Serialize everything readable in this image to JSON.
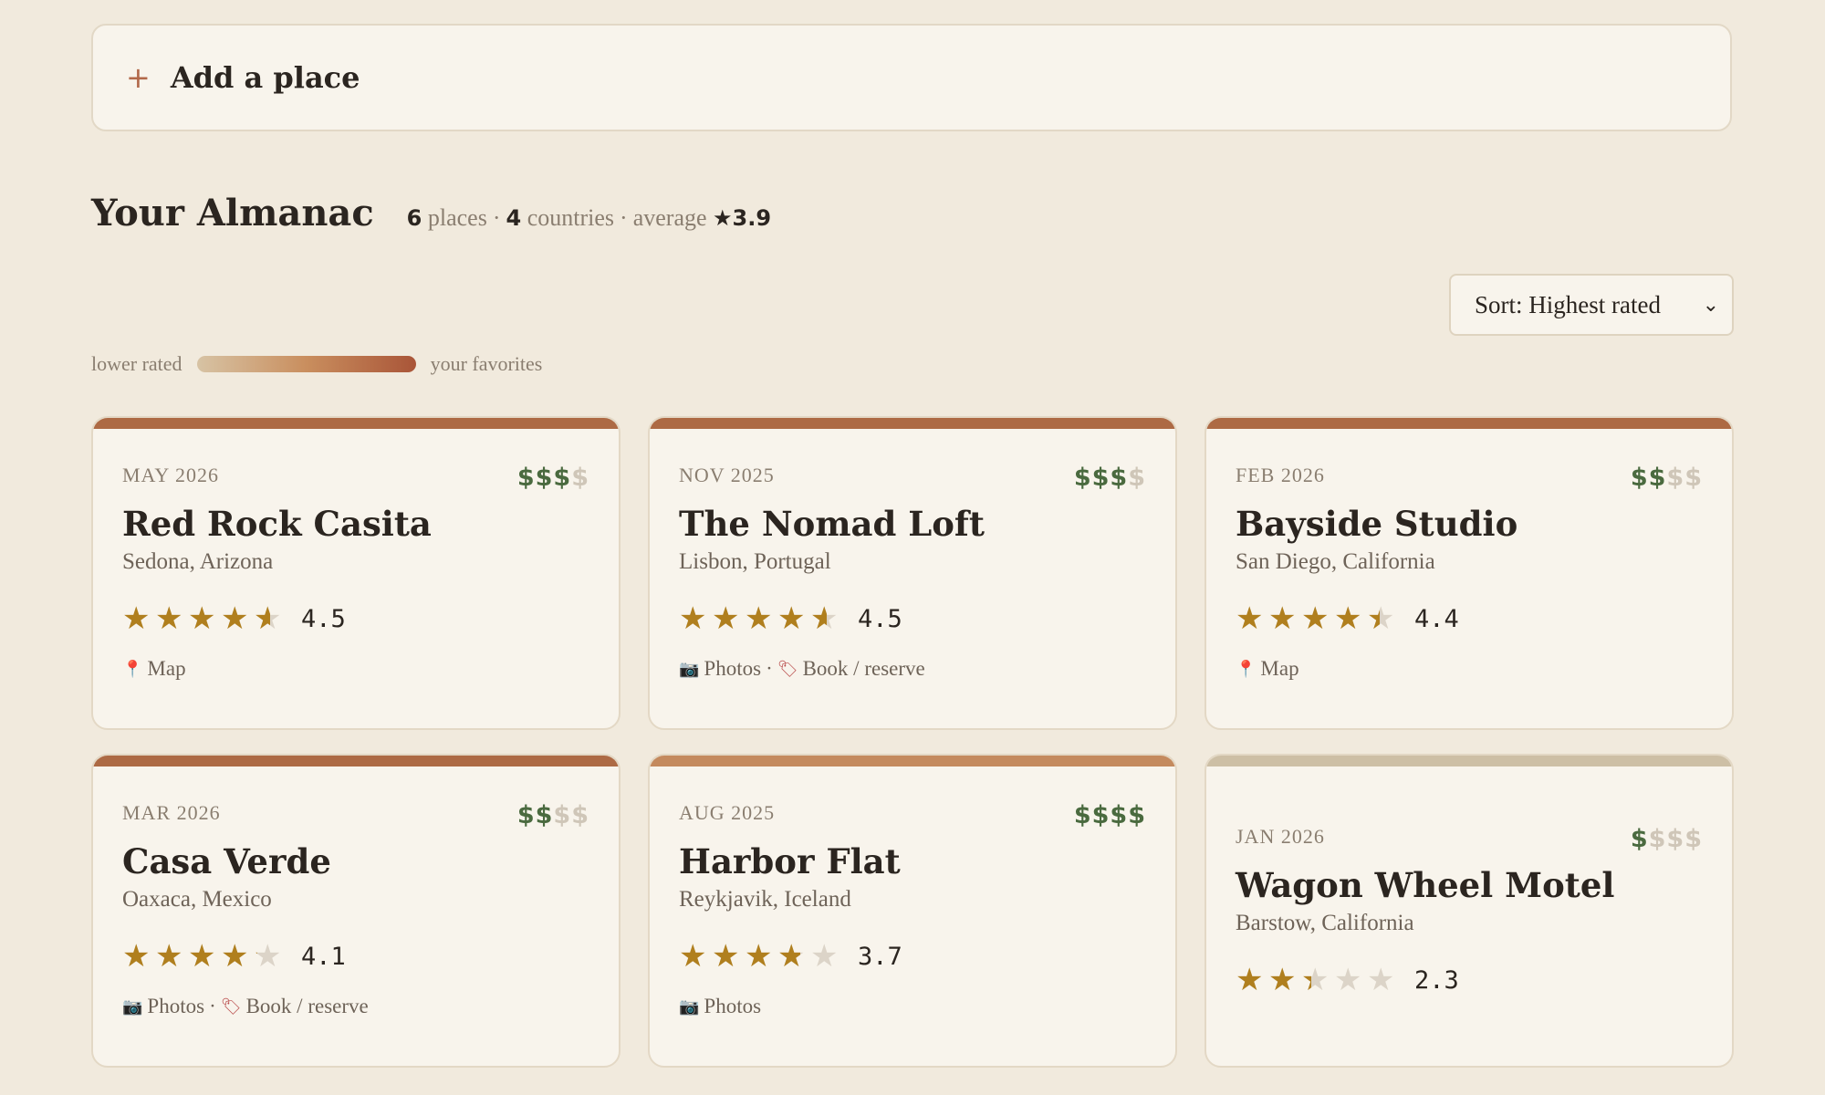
{
  "add_place": {
    "plus": "+",
    "label": "Add a place"
  },
  "almanac": {
    "title": "Your Almanac",
    "places_count": "6",
    "places_label": "places",
    "countries_count": "4",
    "countries_label": "countries",
    "average_label": "average",
    "average_star": "★",
    "average_value": "3.9"
  },
  "sort": {
    "label": "Sort: Highest rated",
    "chevron": "⌄"
  },
  "legend": {
    "low": "lower rated",
    "high": "your favorites"
  },
  "colors": {
    "bar_top": "#ad6a44",
    "bar_mid": "#c48a5e",
    "bar_low": "#cdbfa5",
    "price_on": "#4a6a3f",
    "price_off": "#cfc6b8",
    "star": "#b07f1e"
  },
  "cards": [
    {
      "date": "MAY 2026",
      "price_on": "$$$",
      "price_off": "$",
      "name": "Red Rock Casita",
      "location": "Sedona, Arizona",
      "rating": 4.5,
      "score": "4.5",
      "links": [
        {
          "icon": "map-pin-icon",
          "glyph": "📍",
          "label": "Map"
        }
      ]
    },
    {
      "date": "NOV 2025",
      "price_on": "$$$",
      "price_off": "$",
      "name": "The Nomad Loft",
      "location": "Lisbon, Portugal",
      "rating": 4.5,
      "score": "4.5",
      "links": [
        {
          "icon": "camera-icon",
          "glyph": "📷",
          "label": "Photos"
        },
        {
          "icon": "ticket-icon",
          "glyph": "🏷",
          "label": "Book / reserve"
        }
      ]
    },
    {
      "date": "FEB 2026",
      "price_on": "$$",
      "price_off": "$$",
      "name": "Bayside Studio",
      "location": "San Diego, California",
      "rating": 4.4,
      "score": "4.4",
      "links": [
        {
          "icon": "map-pin-icon",
          "glyph": "📍",
          "label": "Map"
        }
      ]
    },
    {
      "date": "MAR 2026",
      "price_on": "$$",
      "price_off": "$$",
      "name": "Casa Verde",
      "location": "Oaxaca, Mexico",
      "rating": 4.1,
      "score": "4.1",
      "links": [
        {
          "icon": "camera-icon",
          "glyph": "📷",
          "label": "Photos"
        },
        {
          "icon": "ticket-icon",
          "glyph": "🏷",
          "label": "Book / reserve"
        }
      ]
    },
    {
      "date": "AUG 2025",
      "price_on": "$$$$",
      "price_off": "",
      "name": "Harbor Flat",
      "location": "Reykjavik, Iceland",
      "rating": 3.7,
      "score": "3.7",
      "links": [
        {
          "icon": "camera-icon",
          "glyph": "📷",
          "label": "Photos"
        }
      ]
    },
    {
      "date": "JAN 2026",
      "price_on": "$",
      "price_off": "$$$",
      "name": "Wagon Wheel Motel",
      "location": "Barstow, California",
      "rating": 2.3,
      "score": "2.3",
      "links": []
    }
  ]
}
